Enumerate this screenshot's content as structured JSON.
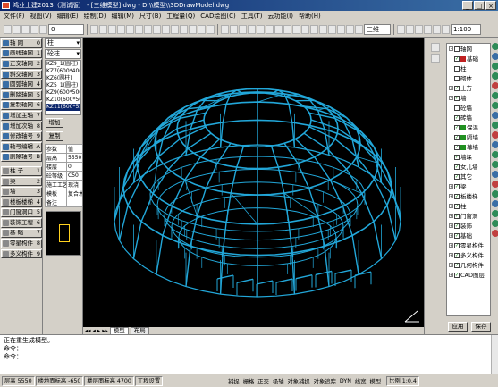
{
  "window": {
    "title": "鸿业土建2013（测试版） - [三维模型].dwg - D:\\\\模型\\\\3DDrawModel.dwg",
    "controls": [
      "_",
      "□",
      "×"
    ]
  },
  "menu": [
    "文件(F)",
    "视图(V)",
    "编辑(E)",
    "绘制(D)",
    "编辑(M)",
    "尺寸(B)",
    "工程量(Q)",
    "CAD绘图(C)",
    "工具(T)",
    "云功能(I)",
    "帮助(H)"
  ],
  "toolbar": {
    "layer_select": "0",
    "view_select": "三维",
    "scale_select": "1:100"
  },
  "left_panel": {
    "items": [
      {
        "label": "轴 网",
        "key": "0"
      },
      {
        "label": "画线轴网",
        "key": "1"
      },
      {
        "label": "正交轴网",
        "key": "2"
      },
      {
        "label": "斜交轴网",
        "key": "3"
      },
      {
        "label": "圆弧轴网",
        "key": "4"
      },
      {
        "label": "删除轴网",
        "key": "5"
      },
      {
        "label": "复制轴网",
        "key": "6"
      },
      {
        "label": "增加主轴",
        "key": "7"
      },
      {
        "label": "增加次轴",
        "key": "8"
      },
      {
        "label": "修改轴号",
        "key": "9"
      },
      {
        "label": "轴号编辑",
        "key": "A"
      },
      {
        "label": "删除轴号",
        "key": "B"
      },
      {
        "label": "柱 子",
        "key": "1"
      },
      {
        "label": "梁",
        "key": "2"
      },
      {
        "label": "墙",
        "key": "3"
      },
      {
        "label": "楼板楼梯",
        "key": "4"
      },
      {
        "label": "门窗洞口",
        "key": "5"
      },
      {
        "label": "装饰工程",
        "key": "6"
      },
      {
        "label": "基 础",
        "key": "7"
      },
      {
        "label": "零星构件",
        "key": "8"
      },
      {
        "label": "多义构件",
        "key": "9"
      }
    ]
  },
  "prop_panel": {
    "type_select": "柱",
    "sub_select": "砼柱",
    "list": [
      "KZ9_1(圆柱)",
      "KZ7(600*400)",
      "KZ6(圆柱)",
      "KZ5_1(圆柱)",
      "KZ9(600*500)",
      "KZ10(600*500)",
      "KZ11(600*550)"
    ],
    "selected_index": 6,
    "add_label": "增加",
    "copy_label": "复制",
    "table": [
      [
        "参数",
        "值"
      ],
      [
        "层高",
        "5550"
      ],
      [
        "楼层",
        "0"
      ],
      [
        "砼等级",
        "C50"
      ],
      [
        "施工工艺",
        "现浇"
      ],
      [
        "模板",
        "复合木"
      ],
      [
        "备注",
        ""
      ]
    ]
  },
  "tabs": [
    "模型",
    "布局"
  ],
  "right_panel": {
    "tree": [
      {
        "label": "轴网",
        "level": 0,
        "checked": false,
        "expand": "-"
      },
      {
        "label": "基础",
        "level": 1,
        "checked": true,
        "color": "#c02020"
      },
      {
        "label": "柱",
        "level": 1,
        "checked": false
      },
      {
        "label": "砌体",
        "level": 1,
        "checked": false
      },
      {
        "label": "土方",
        "level": 0,
        "checked": true,
        "expand": "+"
      },
      {
        "label": "墙",
        "level": 0,
        "checked": true,
        "expand": "-"
      },
      {
        "label": "砼墙",
        "level": 1,
        "checked": false
      },
      {
        "label": "砖墙",
        "level": 1,
        "checked": true
      },
      {
        "label": "保温",
        "level": 1,
        "checked": true,
        "color": "#209020"
      },
      {
        "label": "隔墙",
        "level": 1,
        "checked": true,
        "color": "#209020"
      },
      {
        "label": "幕墙",
        "level": 1,
        "checked": true,
        "color": "#209020"
      },
      {
        "label": "墙垛",
        "level": 1,
        "checked": true
      },
      {
        "label": "女儿墙",
        "level": 1,
        "checked": true
      },
      {
        "label": "其它",
        "level": 1,
        "checked": true
      },
      {
        "label": "梁",
        "level": 0,
        "checked": true,
        "expand": "+"
      },
      {
        "label": "板楼梯",
        "level": 0,
        "checked": true,
        "expand": "+"
      },
      {
        "label": "柱",
        "level": 0,
        "checked": true,
        "expand": "+"
      },
      {
        "label": "门窗洞",
        "level": 0,
        "checked": true,
        "expand": "+"
      },
      {
        "label": "装饰",
        "level": 0,
        "checked": true,
        "expand": "+"
      },
      {
        "label": "基础",
        "level": 0,
        "checked": true,
        "expand": "+"
      },
      {
        "label": "零星构件",
        "level": 0,
        "checked": true,
        "expand": "+"
      },
      {
        "label": "多义构件",
        "level": 0,
        "checked": true,
        "expand": "+"
      },
      {
        "label": "几何构件",
        "level": 0,
        "checked": true,
        "expand": "+"
      },
      {
        "label": "CAD图层",
        "level": 0,
        "checked": true,
        "expand": "+"
      }
    ],
    "apply_label": "应用",
    "save_label": "保存"
  },
  "command": {
    "lines": [
      "正在重生成模型。",
      "命令：",
      "命令："
    ]
  },
  "status": {
    "cells": [
      "层高 5550",
      "楼地面标高 -650",
      "楼层面标高 4700",
      "工程设置"
    ],
    "toggles": [
      "捕捉",
      "栅格",
      "正交",
      "极轴",
      "对象捕捉",
      "对象追踪",
      "DYN",
      "线宽",
      "模型"
    ],
    "coords": "比例 1:0.4"
  }
}
